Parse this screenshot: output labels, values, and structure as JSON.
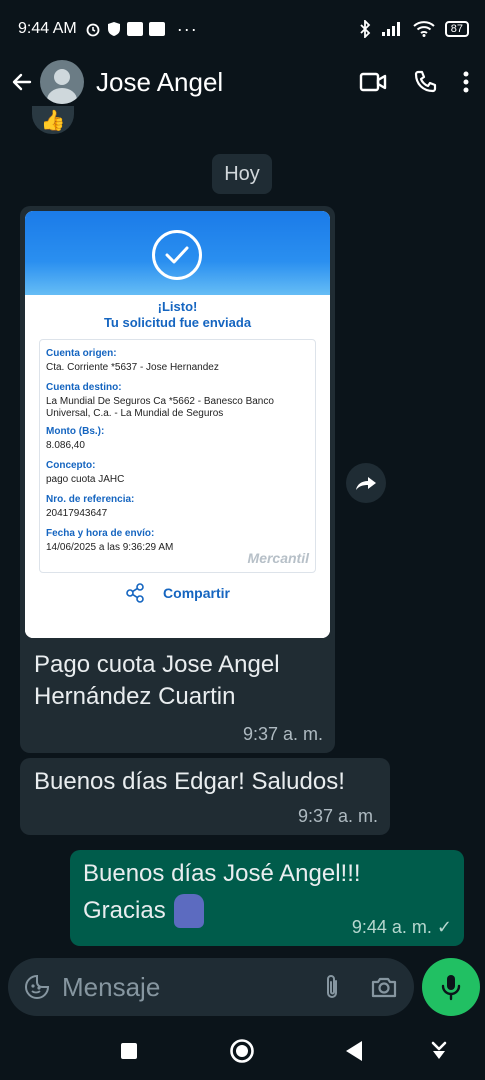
{
  "status_bar": {
    "time": "9:44 AM",
    "battery": "87",
    "more": "···"
  },
  "header": {
    "contact_name": "Jose Angel"
  },
  "chat": {
    "date_chip": "Hoy",
    "receipt": {
      "title_line1": "¡Listo!",
      "title_line2": "Tu solicitud fue enviada",
      "fields": [
        {
          "label": "Cuenta origen:",
          "value": "Cta. Corriente *5637 - Jose Hernandez"
        },
        {
          "label": "Cuenta destino:",
          "value": "La Mundial De Seguros Ca *5662 - Banesco Banco Universal, C.a. - La Mundial de Seguros"
        },
        {
          "label": "Monto (Bs.):",
          "value": "8.086,40"
        },
        {
          "label": "Concepto:",
          "value": "pago cuota JAHC"
        },
        {
          "label": "Nro. de referencia:",
          "value": "20417943647"
        },
        {
          "label": "Fecha y hora de envío:",
          "value": "14/06/2025 a las 9:36:29 AM"
        }
      ],
      "brand": "Mercantil",
      "share_label": "Compartir"
    },
    "messages": [
      {
        "direction": "in",
        "text": "Pago cuota Jose Angel Hernández Cuartin",
        "time": "9:37 a. m."
      },
      {
        "direction": "in",
        "text": "Buenos días Edgar! Saludos!",
        "time": "9:37 a. m."
      },
      {
        "direction": "out",
        "text_line1": "Buenos días José Angel!!!",
        "text_line2": "Gracias",
        "time": "9:44 a. m. ✓"
      }
    ]
  },
  "input": {
    "placeholder": "Mensaje"
  },
  "colors": {
    "background": "#0b141a",
    "incoming": "#202c33",
    "outgoing": "#005c4b",
    "accent": "#21c063"
  }
}
